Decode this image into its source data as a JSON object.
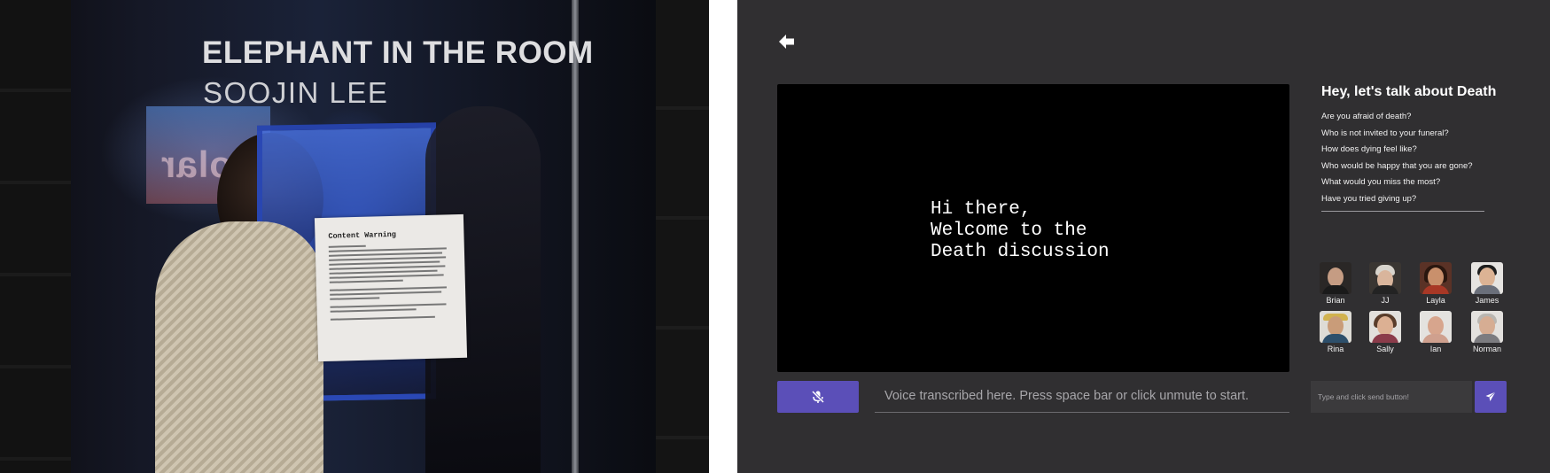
{
  "photo": {
    "title_line1": "ELEPHANT IN THE ROOM",
    "title_line2": "SOOJIN LEE",
    "sign_text": "Solar",
    "paper_title": "Content Warning"
  },
  "app": {
    "back_icon": "arrow-left-icon",
    "video_text": "Hi there,\nWelcome to the\nDeath discussion",
    "topic": {
      "title": "Hey, let's talk about Death",
      "questions": [
        "Are you afraid of death?",
        "Who is not invited to your funeral?",
        "How does dying feel like?",
        "Who would be happy that you are gone?",
        "What would you miss the most?",
        "Have you tried giving up?"
      ]
    },
    "avatars": [
      {
        "name": "Brian"
      },
      {
        "name": "JJ"
      },
      {
        "name": "Layla"
      },
      {
        "name": "James"
      },
      {
        "name": "Rina"
      },
      {
        "name": "Sally"
      },
      {
        "name": "Ian"
      },
      {
        "name": "Norman"
      }
    ],
    "mute_icon": "microphone-muted-icon",
    "transcript_placeholder": "Voice transcribed here. Press space bar or click unmute to start.",
    "chat_placeholder": "Type and click send button!",
    "send_icon": "paper-plane-icon",
    "colors": {
      "background": "#302f31",
      "accent": "#5b4fb8",
      "video_bg": "#000000"
    }
  }
}
